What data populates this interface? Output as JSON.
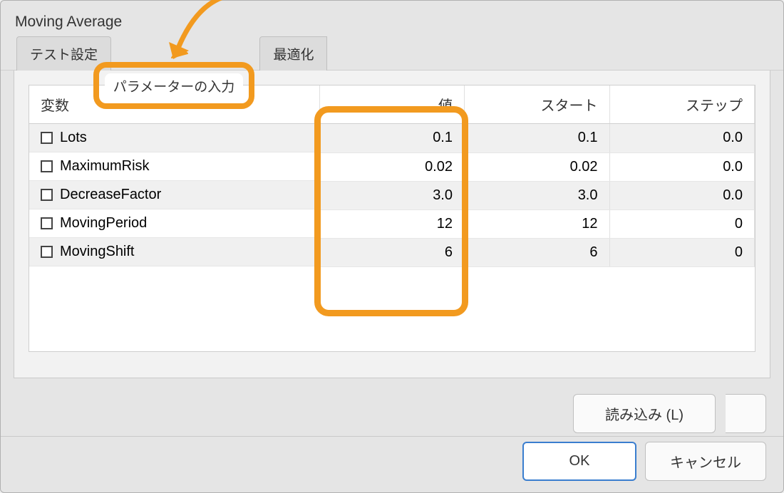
{
  "window": {
    "title": "Moving Average"
  },
  "tabs": {
    "test_settings": "テスト設定",
    "parameter_input": "パラメーターの入力",
    "optimization": "最適化"
  },
  "table": {
    "headers": {
      "variable": "変数",
      "value": "値",
      "start": "スタート",
      "step": "ステップ"
    },
    "rows": [
      {
        "name": "Lots",
        "value": "0.1",
        "start": "0.1",
        "step": "0.0"
      },
      {
        "name": "MaximumRisk",
        "value": "0.02",
        "start": "0.02",
        "step": "0.0"
      },
      {
        "name": "DecreaseFactor",
        "value": "3.0",
        "start": "3.0",
        "step": "0.0"
      },
      {
        "name": "MovingPeriod",
        "value": "12",
        "start": "12",
        "step": "0"
      },
      {
        "name": "MovingShift",
        "value": "6",
        "start": "6",
        "step": "0"
      }
    ]
  },
  "buttons": {
    "load": "読み込み (L)",
    "ok": "OK",
    "cancel": "キャンセル"
  }
}
